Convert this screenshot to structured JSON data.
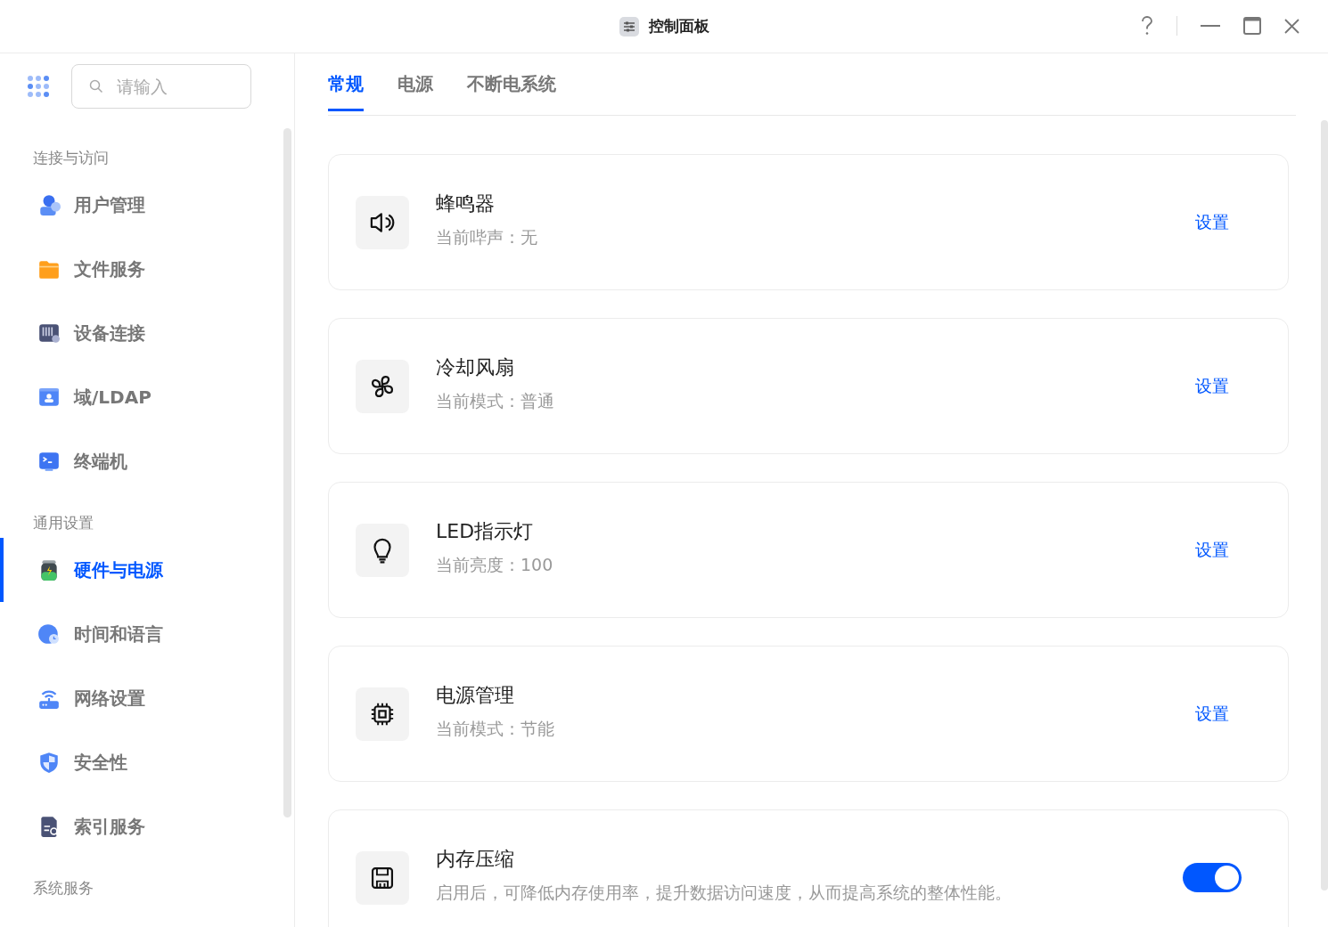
{
  "window": {
    "title": "控制面板"
  },
  "sidebar": {
    "search": {
      "placeholder": "请输入"
    },
    "sections": [
      {
        "label": "连接与访问",
        "items": [
          {
            "label": "用户管理",
            "selected": false
          },
          {
            "label": "文件服务",
            "selected": false
          },
          {
            "label": "设备连接",
            "selected": false
          },
          {
            "label": "域/LDAP",
            "selected": false
          },
          {
            "label": "终端机",
            "selected": false
          }
        ]
      },
      {
        "label": "通用设置",
        "items": [
          {
            "label": "硬件与电源",
            "selected": true
          },
          {
            "label": "时间和语言",
            "selected": false
          },
          {
            "label": "网络设置",
            "selected": false
          },
          {
            "label": "安全性",
            "selected": false
          },
          {
            "label": "索引服务",
            "selected": false
          }
        ]
      },
      {
        "label": "系统服务"
      }
    ]
  },
  "tabs": [
    {
      "label": "常规",
      "selected": true
    },
    {
      "label": "电源",
      "selected": false
    },
    {
      "label": "不断电系统",
      "selected": false
    }
  ],
  "cards": [
    {
      "kind": "link",
      "title": "蜂鸣器",
      "detail": "当前哔声：无",
      "action": "设置"
    },
    {
      "kind": "link",
      "title": "冷却风扇",
      "detail": "当前模式：普通",
      "action": "设置"
    },
    {
      "kind": "link",
      "title": "LED指示灯",
      "detail": "当前亮度：100",
      "action": "设置"
    },
    {
      "kind": "link",
      "title": "电源管理",
      "detail": "当前模式：节能",
      "action": "设置"
    },
    {
      "kind": "toggle",
      "title": "内存压缩",
      "detail": "启用后，可降低内存使用率，提升数据访问速度，从而提高系统的整体性能。",
      "on": true
    }
  ]
}
